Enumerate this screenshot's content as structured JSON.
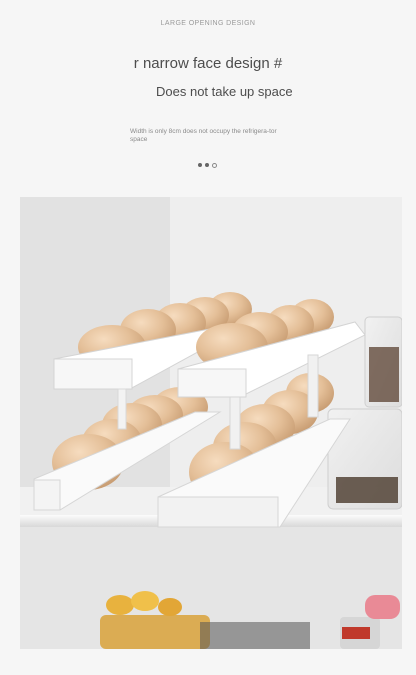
{
  "header": {
    "caption": "LARGE OPENING DESIGN",
    "headline": "r narrow face design #",
    "subhead": "Does not take up space",
    "description": "Width is only 8cm does not occupy the refrigera-tor space"
  },
  "pagination": {
    "total": 3,
    "active": 2
  },
  "photo": {
    "subject": "egg-rack-in-refrigerator",
    "colors": {
      "egg": "#e6c29c",
      "rack": "#ffffff",
      "fridge": "#ebebeb"
    }
  }
}
